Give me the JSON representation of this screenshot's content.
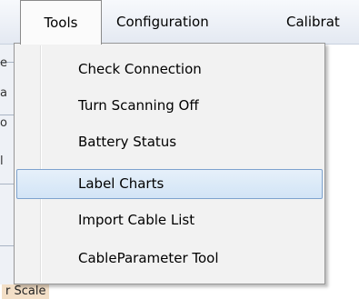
{
  "menubar": {
    "items": [
      {
        "label": "Tools",
        "open": true
      },
      {
        "label": "Configuration"
      },
      {
        "label": "Calibrat"
      }
    ]
  },
  "tools_menu": {
    "items": [
      {
        "label": "Check Connection"
      },
      {
        "label": "Turn Scanning Off"
      },
      {
        "label": "Battery Status"
      },
      {
        "label": "Label Charts",
        "highlighted": true
      },
      {
        "label": "Import Cable List"
      },
      {
        "label": "CableParameter Tool"
      }
    ]
  },
  "background": {
    "bottom_text": "r Scale",
    "glyphs": [
      "e",
      "a",
      "o",
      "l"
    ]
  },
  "colors": {
    "highlight_fill": "#d2e4f6",
    "highlight_border": "#7da2ce",
    "menu_bg": "#f2f2f2"
  }
}
